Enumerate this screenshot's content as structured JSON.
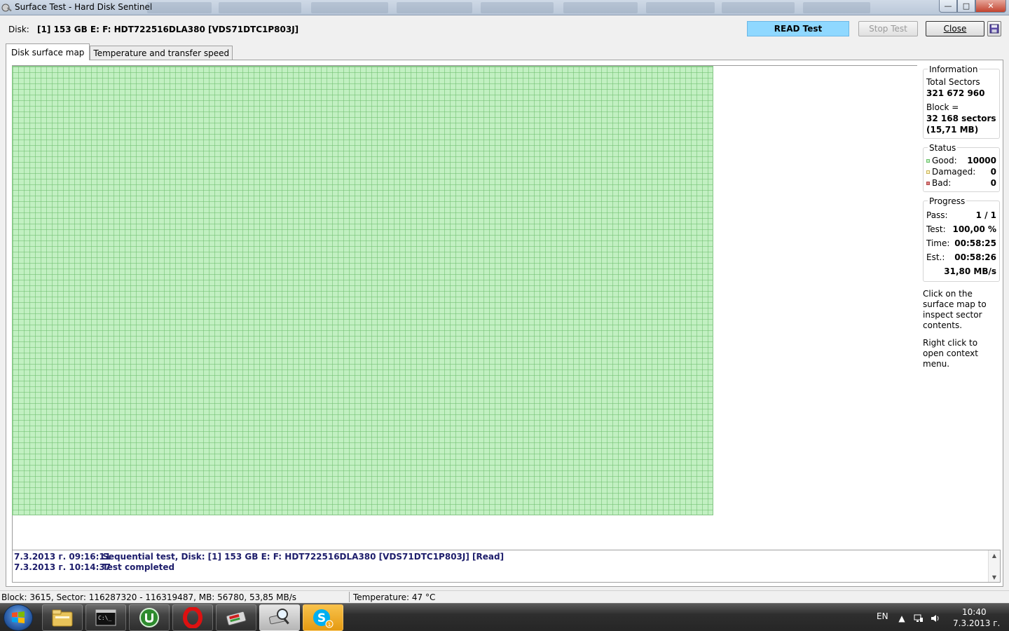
{
  "window": {
    "title": "Surface Test - Hard Disk Sentinel",
    "minimize": "—",
    "maximize": "□",
    "close": "✕"
  },
  "toolbar": {
    "disk_label": "Disk:",
    "disk_value": "[1] 153 GB E: F: HDT722516DLA380 [VDS71DTC1P803J]",
    "read_test": "READ Test",
    "stop_test": "Stop Test",
    "close": "Close"
  },
  "tabs": [
    {
      "label": "Disk surface map",
      "active": true
    },
    {
      "label": "Temperature and transfer speed",
      "active": false
    }
  ],
  "info": {
    "title": "Information",
    "total_sectors_label": "Total Sectors",
    "total_sectors_value": "321 672 960",
    "block_label": "Block =",
    "block_sectors": "32 168 sectors",
    "block_mb": "(15,71 MB)"
  },
  "status": {
    "title": "Status",
    "good_label": "Good:",
    "good_value": "10000",
    "damaged_label": "Damaged:",
    "damaged_value": "0",
    "bad_label": "Bad:",
    "bad_value": "0",
    "good_color": "#8fd88f",
    "damaged_color": "#f2e08a",
    "bad_color": "#e08080"
  },
  "progress": {
    "title": "Progress",
    "pass_label": "Pass:",
    "pass_value": "1 / 1",
    "test_label": "Test:",
    "test_value": "100,00 %",
    "time_label": "Time:",
    "time_value": "00:58:25",
    "est_label": "Est.:",
    "est_value": "00:58:26",
    "speed": "31,80 MB/s"
  },
  "hints": {
    "click": "Click on the surface map to inspect sector contents.",
    "right_click": "Right click to open context menu."
  },
  "log": [
    {
      "time": "7.3.2013 г.  09:16:11",
      "message": "Sequential test, Disk: [1] 153 GB E: F: HDT722516DLA380 [VDS71DTC1P803J] [Read]"
    },
    {
      "time": "7.3.2013 г.  10:14:37",
      "message": "Test completed"
    }
  ],
  "statusbar": {
    "block_info": "Block: 3615, Sector: 116287320 - 116319487, MB: 56780, 53,85 MB/s",
    "temperature": "Temperature: 47  °C"
  },
  "taskbar": {
    "language": "EN",
    "time": "10:40",
    "date": "7.3.2013 г.",
    "skype_badge": "1"
  },
  "colors": {
    "map_fill": "#c2f0c2",
    "read_button": "#8fd8ff",
    "log_text": "#1d1d6b"
  }
}
